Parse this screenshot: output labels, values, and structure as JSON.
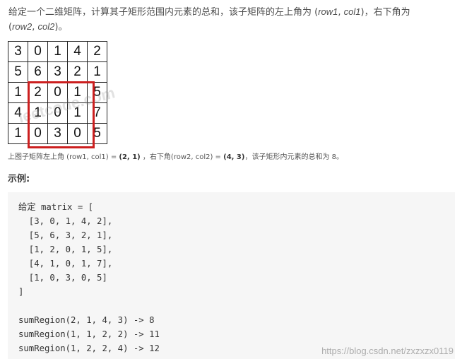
{
  "intro": {
    "text_1": "给定一个二维矩阵，计算其子矩形范围内元素的总和，该子矩阵的左上角为 (",
    "row1": "row",
    "row1_num": "1",
    "comma1": ", ",
    "col1": "col",
    "col1_num": "1",
    "text_2": ")，右下角为",
    "text_3": "(",
    "row2": "row",
    "row2_num": "2",
    "comma2": ", ",
    "col2": "col",
    "col2_num": "2",
    "text_4": ")。"
  },
  "matrix": [
    [
      "3",
      "0",
      "1",
      "4",
      "2"
    ],
    [
      "5",
      "6",
      "3",
      "2",
      "1"
    ],
    [
      "1",
      "2",
      "0",
      "1",
      "5"
    ],
    [
      "4",
      "1",
      "0",
      "1",
      "7"
    ],
    [
      "1",
      "0",
      "3",
      "0",
      "5"
    ]
  ],
  "watermark": "leetcode.com",
  "caption": {
    "part1": "上图子矩阵左上角 (row1, col1) = ",
    "b1": "(2, 1)",
    "part2": " ，右下角(row2, col2) = ",
    "b2": "(4, 3)",
    "part3": "，该子矩形内元素的总和为 8。"
  },
  "section_title": "示例:",
  "code": "给定 matrix = [\n  [3, 0, 1, 4, 2],\n  [5, 6, 3, 2, 1],\n  [1, 2, 0, 1, 5],\n  [4, 1, 0, 1, 7],\n  [1, 0, 3, 0, 5]\n]\n\nsumRegion(2, 1, 4, 3) -> 8\nsumRegion(1, 1, 2, 2) -> 11\nsumRegion(1, 2, 2, 4) -> 12",
  "signature": "https://blog.csdn.net/zxzxzx0119",
  "colors": {
    "highlight": "#cc1f1f",
    "code_bg": "#f6f6f6"
  }
}
